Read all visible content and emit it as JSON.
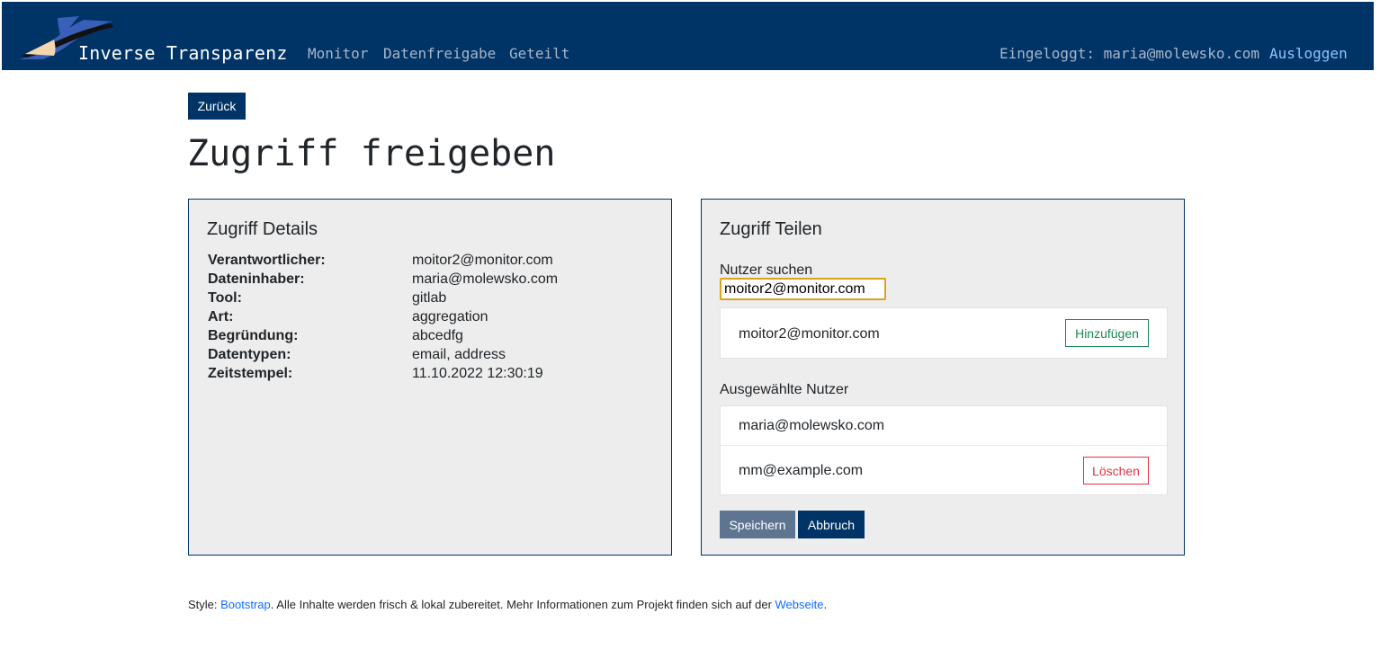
{
  "navbar": {
    "brand": "Inverse Transparenz",
    "links": [
      "Monitor",
      "Datenfreigabe",
      "Geteilt"
    ],
    "login_text": "Eingeloggt: maria@molewsko.com",
    "logout_label": "Ausloggen",
    "background_color": "#003366"
  },
  "back_button": "Zurück",
  "page_title": "Zugriff freigeben",
  "details": {
    "title": "Zugriff Details",
    "rows": [
      {
        "key": "Verantwortlicher:",
        "value": "moitor2@monitor.com"
      },
      {
        "key": "Dateninhaber:",
        "value": "maria@molewsko.com"
      },
      {
        "key": "Tool:",
        "value": "gitlab"
      },
      {
        "key": "Art:",
        "value": "aggregation"
      },
      {
        "key": "Begründung:",
        "value": "abcedfg"
      },
      {
        "key": "Datentypen:",
        "value": "email, address"
      },
      {
        "key": "Zeitstempel:",
        "value": "11.10.2022 12:30:19"
      }
    ]
  },
  "share": {
    "title": "Zugriff Teilen",
    "search_label": "Nutzer suchen",
    "search_value": "moitor2@monitor.com",
    "search_result": "moitor2@monitor.com",
    "add_label": "Hinzufügen",
    "selected_label": "Ausgewählte Nutzer",
    "selected_users": [
      {
        "email": "maria@molewsko.com"
      },
      {
        "email": "mm@example.com",
        "delete_label": "Löschen"
      }
    ],
    "save_label": "Speichern",
    "cancel_label": "Abbruch"
  },
  "footer": {
    "prefix": "Style: ",
    "bootstrap_link": "Bootstrap",
    "middle": ". Alle Inhalte werden frisch & lokal zubereitet. Mehr Informationen zum Projekt finden sich auf der ",
    "website_link": "Webseite",
    "suffix": "."
  }
}
